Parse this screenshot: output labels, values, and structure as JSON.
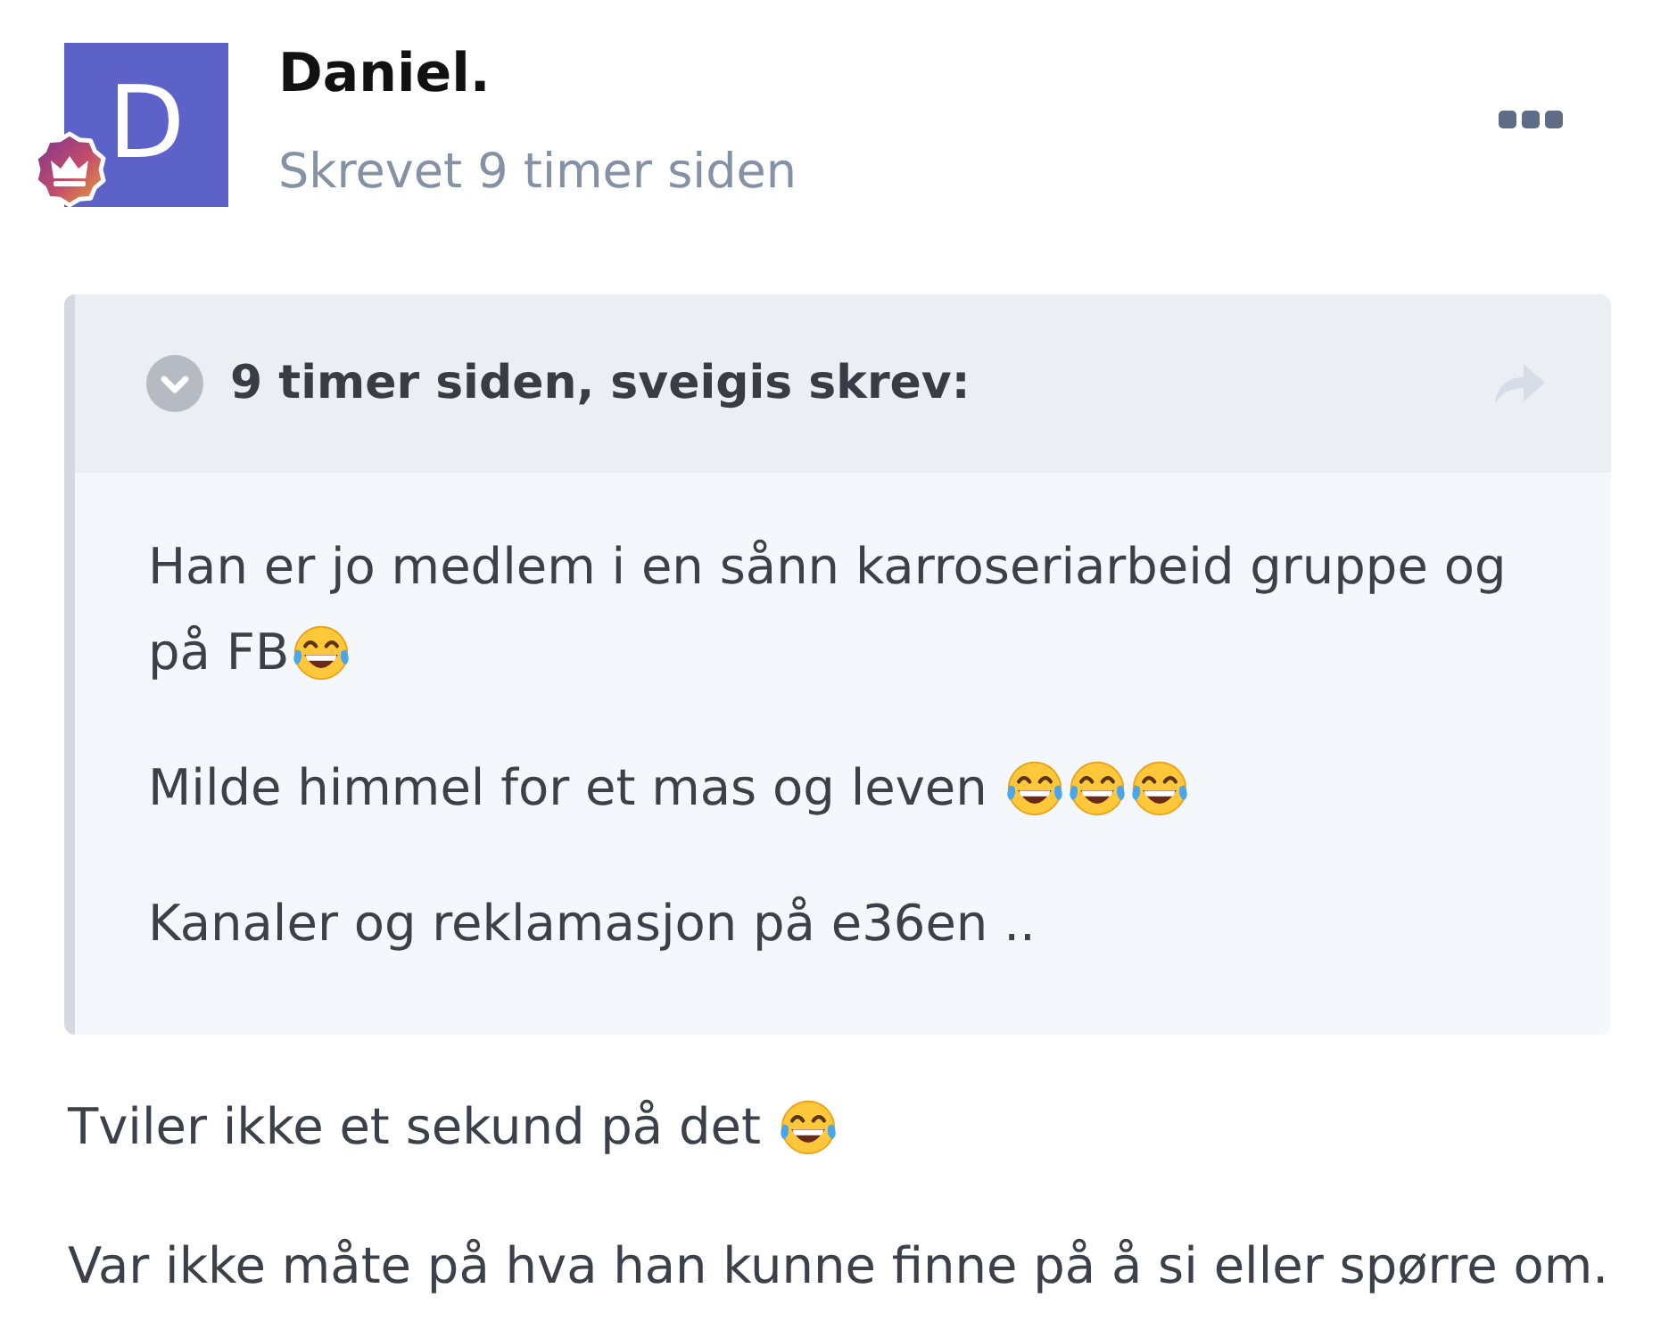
{
  "post": {
    "author": {
      "avatar_initial": "D",
      "name": "Daniel."
    },
    "timestamp": "Skrevet 9 timer siden"
  },
  "quote": {
    "header": "9 timer siden, sveigis skrev:",
    "paragraphs": [
      {
        "lines": [
          {
            "parts": [
              {
                "kind": "text",
                "text": "Han er jo medlem i en sånn karroseriarbeid gruppe og"
              }
            ]
          },
          {
            "parts": [
              {
                "kind": "text",
                "text": "på FB"
              },
              {
                "kind": "emoji"
              }
            ]
          }
        ]
      },
      {
        "lines": [
          {
            "parts": [
              {
                "kind": "text",
                "text": "Milde himmel for et mas og leven "
              },
              {
                "kind": "emoji"
              },
              {
                "kind": "emoji"
              },
              {
                "kind": "emoji"
              }
            ]
          }
        ]
      },
      {
        "lines": [
          {
            "parts": [
              {
                "kind": "text",
                "text": "Kanaler og reklamasjon på e36en .."
              }
            ]
          }
        ]
      }
    ]
  },
  "paragraphs": [
    {
      "lines": [
        {
          "parts": [
            {
              "kind": "text",
              "text": "Tviler ikke et sekund på det "
            },
            {
              "kind": "emoji"
            }
          ]
        }
      ]
    },
    {
      "lines": [
        {
          "parts": [
            {
              "kind": "text",
              "text": "Var ikke måte på hva han kunne finne på å si eller spørre om."
            }
          ]
        }
      ]
    }
  ]
}
